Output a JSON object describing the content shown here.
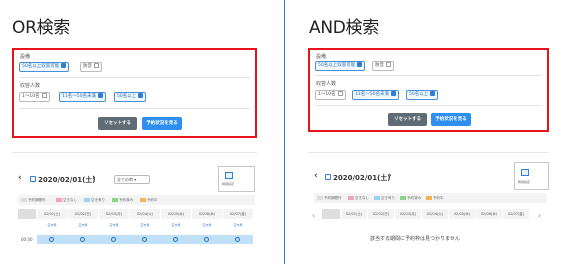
{
  "left": {
    "heading": "OR検索",
    "equipment_label": "設備",
    "equip_tags": [
      {
        "label": "50名以上収容可能",
        "checked": true
      },
      {
        "label": "防音",
        "checked": false
      }
    ],
    "capacity_label": "収容人数",
    "cap_tags": [
      {
        "label": "1〜10名",
        "checked": false
      },
      {
        "label": "11名〜50名未満",
        "checked": true
      },
      {
        "label": "50名以上",
        "checked": true
      }
    ],
    "reset_label": "リセットする",
    "search_label": "予約状況を見る",
    "date": "2020/02/01(土)",
    "select_label": "全ての時",
    "thumb_label": "時間指定",
    "legend": [
      "予約期間外",
      "空きなし",
      "空き有り",
      "予約済み",
      "予約中"
    ],
    "days": [
      "02/01(土)",
      "02/02(日)",
      "02/03(月)",
      "02/04(火)",
      "02/05(水)",
      "02/06(木)",
      "02/07(金)"
    ],
    "sub": "空き枠",
    "time": "00:00"
  },
  "right": {
    "heading": "AND検索",
    "equipment_label": "設備",
    "equip_tags": [
      {
        "label": "50名以上収容可能",
        "checked": true
      },
      {
        "label": "防音",
        "checked": false
      }
    ],
    "capacity_label": "収容人数",
    "cap_tags": [
      {
        "label": "1〜10名",
        "checked": false
      },
      {
        "label": "11名〜50名未満",
        "checked": true
      },
      {
        "label": "50名以上",
        "checked": true
      }
    ],
    "reset_label": "リセットする",
    "search_label": "予約状況を見る",
    "date": "2020/02/01(土)",
    "thumb_label": "時間指定",
    "legend": [
      "予約期間外",
      "空きなし",
      "空き有り",
      "予約済み",
      "予約中"
    ],
    "days": [
      "02/01(土)",
      "02/02(日)",
      "02/03(月)",
      "02/04(火)",
      "02/05(水)",
      "02/06(木)",
      "02/07(金)"
    ],
    "empty_message": "該当する期間に予約枠は見つかりません"
  },
  "colors": {
    "highlight_border": "#e8141b",
    "accent": "#2f8ff0",
    "divider": "#3a78c2",
    "available_row": "#bfe0f6"
  }
}
